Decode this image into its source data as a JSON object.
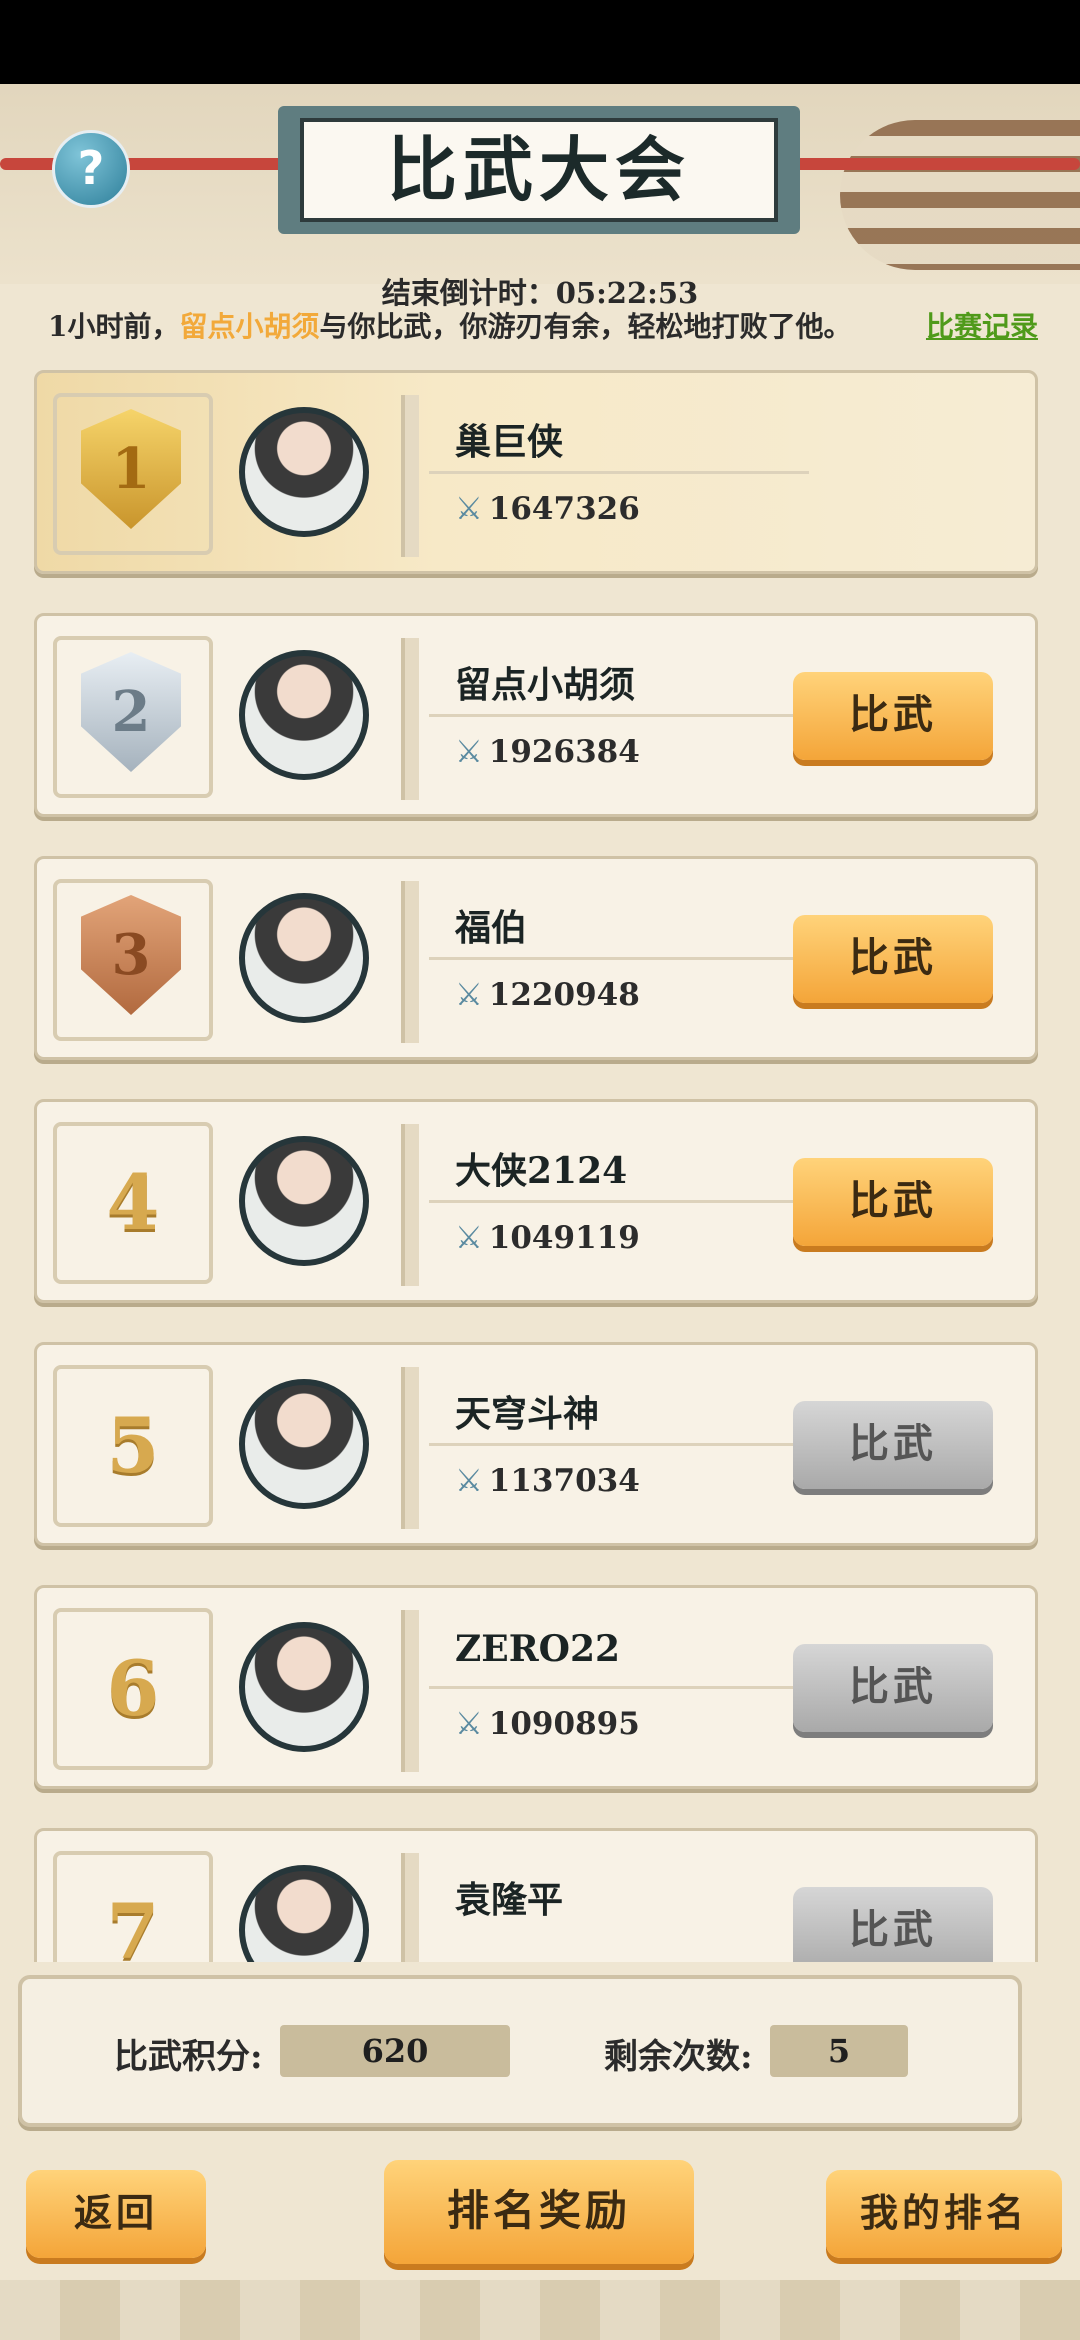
{
  "header": {
    "title": "比武大会",
    "help_icon": "question-icon",
    "countdown": "结束倒计时：05:22:53"
  },
  "message": {
    "prefix": "1小时前，",
    "opponent": "留点小胡须",
    "suffix": "与你比武，你游刃有余，轻松地打败了他。",
    "link": "比赛记录"
  },
  "ranking": [
    {
      "rank": "1",
      "name": "巢巨侠",
      "power": "1647326",
      "button": "",
      "state": "self"
    },
    {
      "rank": "2",
      "name": "留点小胡须",
      "power": "1926384",
      "button": "比武",
      "state": "active"
    },
    {
      "rank": "3",
      "name": "福伯",
      "power": "1220948",
      "button": "比武",
      "state": "active"
    },
    {
      "rank": "4",
      "name": "大侠2124",
      "power": "1049119",
      "button": "比武",
      "state": "active"
    },
    {
      "rank": "5",
      "name": "天穹斗神",
      "power": "1137034",
      "button": "比武",
      "state": "inactive"
    },
    {
      "rank": "6",
      "name": "ZERO22",
      "power": "1090895",
      "button": "比武",
      "state": "inactive"
    },
    {
      "rank": "7",
      "name": "袁隆平",
      "power": "",
      "button": "比武",
      "state": "inactive"
    }
  ],
  "stats": {
    "score_label": "比武积分:",
    "score_value": "620",
    "remaining_label": "剩余次数:",
    "remaining_value": "5"
  },
  "footer": {
    "back": "返回",
    "rewards": "排名奖励",
    "my_rank": "我的排名"
  },
  "colors": {
    "accent_orange": "#f4a539",
    "highlight_name": "#f2a93a",
    "link_green": "#4f9a1a"
  }
}
